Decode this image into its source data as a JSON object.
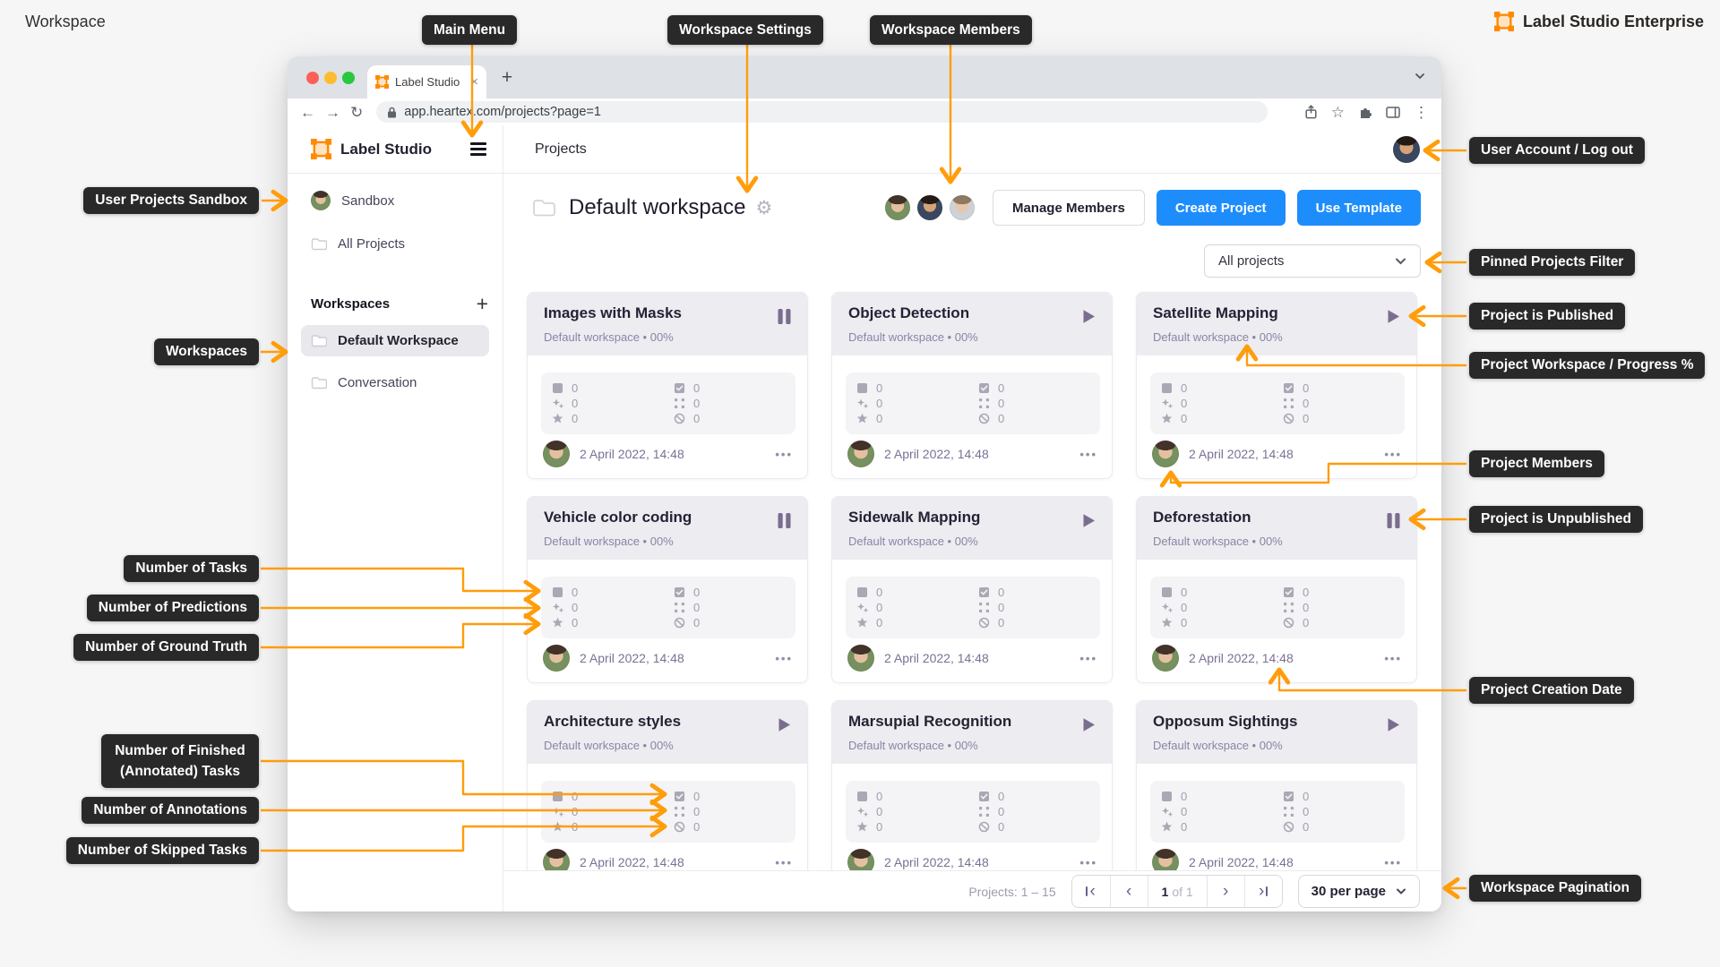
{
  "page": {
    "corner_label": "Workspace",
    "brand": "Label Studio Enterprise"
  },
  "callouts": {
    "main_menu": "Main Menu",
    "workspace_settings": "Workspace Settings",
    "workspace_members": "Workspace Members",
    "user_projects_sandbox": "User Projects Sandbox",
    "workspaces": "Workspaces",
    "number_of_tasks": "Number of Tasks",
    "number_of_predictions": "Number of Predictions",
    "number_of_ground_truth": "Number of Ground Truth",
    "number_of_finished": "Number of Finished (Annotated) Tasks",
    "number_of_annotations": "Number of Annotations",
    "number_of_skipped": "Number of Skipped Tasks",
    "user_account": "User Account / Log out",
    "pinned_projects_filter": "Pinned Projects Filter",
    "project_is_published": "Project is Published",
    "project_workspace_progress": "Project Workspace / Progress %",
    "project_members": "Project Members",
    "project_is_unpublished": "Project is Unpublished",
    "project_creation_date": "Project Creation Date",
    "workspace_pagination": "Workspace Pagination"
  },
  "browser": {
    "tab_title": "Label Studio",
    "url": "app.heartex.com/projects?page=1"
  },
  "app": {
    "logo_text": "Label Studio",
    "page_title": "Projects",
    "sidebar": {
      "sandbox": "Sandbox",
      "all_projects": "All Projects",
      "workspaces_header": "Workspaces",
      "workspaces": [
        {
          "label": "Default Workspace",
          "selected": true
        },
        {
          "label": "Conversation",
          "selected": false
        }
      ]
    },
    "workspace": {
      "title": "Default workspace",
      "manage_members": "Manage Members",
      "create_project": "Create Project",
      "use_template": "Use Template",
      "filter_selected": "All projects"
    },
    "projects": [
      {
        "name": "Images with Masks",
        "status": "paused",
        "subtitle": "Default workspace • 00%",
        "date": "2 April 2022, 14:48",
        "stats": {
          "tasks": "0",
          "finished": "0",
          "predictions": "0",
          "annotations": "0",
          "ground_truth": "0",
          "skipped": "0"
        }
      },
      {
        "name": "Object Detection",
        "status": "published",
        "subtitle": "Default workspace • 00%",
        "date": "2 April 2022, 14:48",
        "stats": {
          "tasks": "0",
          "finished": "0",
          "predictions": "0",
          "annotations": "0",
          "ground_truth": "0",
          "skipped": "0"
        }
      },
      {
        "name": "Satellite Mapping",
        "status": "published",
        "subtitle": "Default workspace • 00%",
        "date": "2 April 2022, 14:48",
        "stats": {
          "tasks": "0",
          "finished": "0",
          "predictions": "0",
          "annotations": "0",
          "ground_truth": "0",
          "skipped": "0"
        }
      },
      {
        "name": "Vehicle color coding",
        "status": "paused",
        "subtitle": "Default workspace • 00%",
        "date": "2 April 2022, 14:48",
        "stats": {
          "tasks": "0",
          "finished": "0",
          "predictions": "0",
          "annotations": "0",
          "ground_truth": "0",
          "skipped": "0"
        }
      },
      {
        "name": "Sidewalk Mapping",
        "status": "published",
        "subtitle": "Default workspace • 00%",
        "date": "2 April 2022, 14:48",
        "stats": {
          "tasks": "0",
          "finished": "0",
          "predictions": "0",
          "annotations": "0",
          "ground_truth": "0",
          "skipped": "0"
        }
      },
      {
        "name": "Deforestation",
        "status": "paused",
        "subtitle": "Default workspace • 00%",
        "date": "2 April 2022, 14:48",
        "stats": {
          "tasks": "0",
          "finished": "0",
          "predictions": "0",
          "annotations": "0",
          "ground_truth": "0",
          "skipped": "0"
        }
      },
      {
        "name": "Architecture styles",
        "status": "published",
        "subtitle": "Default workspace • 00%",
        "date": "2 April 2022, 14:48",
        "stats": {
          "tasks": "0",
          "finished": "0",
          "predictions": "0",
          "annotations": "0",
          "ground_truth": "0",
          "skipped": "0"
        }
      },
      {
        "name": "Marsupial Recognition",
        "status": "published",
        "subtitle": "Default workspace • 00%",
        "date": "2 April 2022, 14:48",
        "stats": {
          "tasks": "0",
          "finished": "0",
          "predictions": "0",
          "annotations": "0",
          "ground_truth": "0",
          "skipped": "0"
        }
      },
      {
        "name": "Opposum Sightings",
        "status": "published",
        "subtitle": "Default workspace • 00%",
        "date": "2 April 2022, 14:48",
        "stats": {
          "tasks": "0",
          "finished": "0",
          "predictions": "0",
          "annotations": "0",
          "ground_truth": "0",
          "skipped": "0"
        }
      }
    ],
    "pagination": {
      "summary": "Projects: 1 – 15",
      "current": "1",
      "of": "of 1",
      "per_page": "30 per page"
    }
  },
  "colors": {
    "accent_orange": "#FF9D0A",
    "brand_orange": "#FF8A00",
    "primary_blue": "#1E8DFC",
    "callout_bg": "#292929",
    "status_purple": "#7B6D90"
  }
}
